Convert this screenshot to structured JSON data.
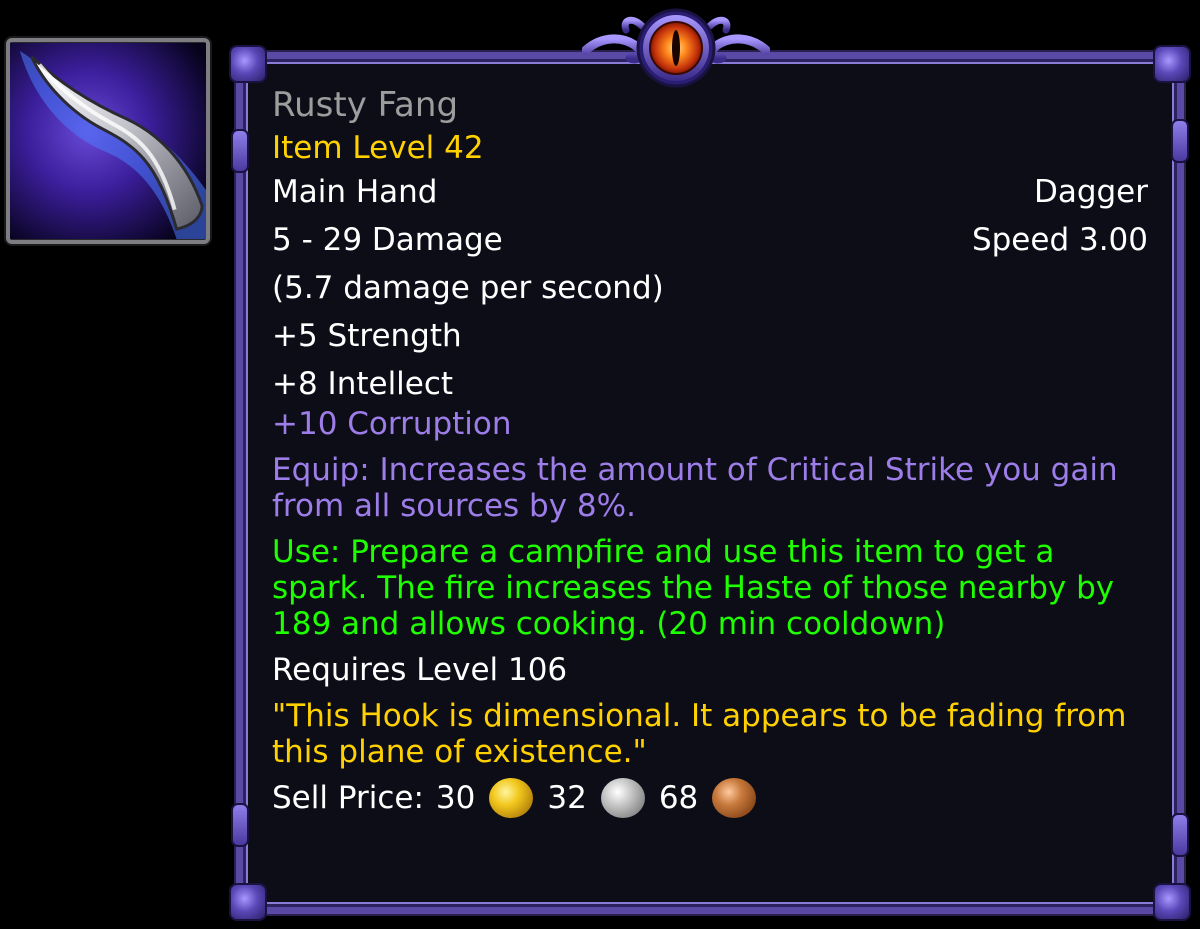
{
  "item": {
    "name": "Rusty Fang",
    "item_level": "Item Level 42",
    "slot": "Main Hand",
    "type": "Dagger",
    "damage": "5 - 29 Damage",
    "speed": "Speed 3.00",
    "dps": "(5.7 damage per second)",
    "stats": [
      "+5 Strength",
      "+8 Intellect"
    ],
    "corruption": "+10 Corruption",
    "equip": "Equip: Increases the amount of Critical Strike you gain from all sources by 8%.",
    "use": "Use: Prepare a campfire and use this item to get a spark. The fire increases the Haste of those nearby by 189 and allows cooking. (20 min cooldown)",
    "requires": "Requires Level 106",
    "flavor": "\"This Hook is dimensional. It appears to be fading from this plane of existence.\"",
    "sell": {
      "label": "Sell Price:",
      "gold": "30",
      "silver": "32",
      "copper": "68"
    },
    "icon": "dagger-icon"
  },
  "colors": {
    "name_quality": "#9d9d9d",
    "item_level": "#ffd100",
    "corruption": "#9d7de8",
    "use": "#1eff00",
    "flavor": "#ffd100",
    "frame": "#5a4aa6",
    "background": "#0d0d18"
  }
}
